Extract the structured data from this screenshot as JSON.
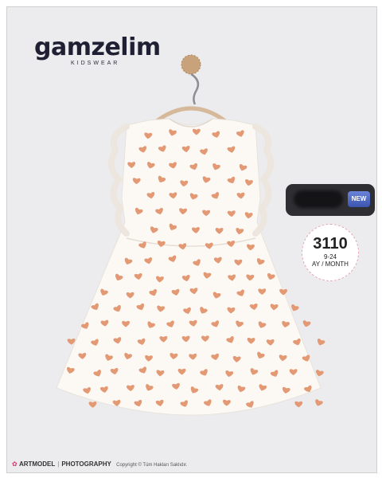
{
  "brand": {
    "name": "gamzelim",
    "tagline": "KIDSWEAR"
  },
  "badge": {
    "new_label": "NEW"
  },
  "size": {
    "code": "3110",
    "range": "9-24",
    "unit": "AY / MONTH"
  },
  "footer": {
    "studio": "ARTMODEL",
    "studio_suffix": "PHOTOGRAPHY",
    "copyright": "Copyright © Tüm Hakları Saklıdır."
  },
  "colors": {
    "heart": "#e39a74",
    "dress": "#fcf9f5",
    "background": "#ececee",
    "hanger_knob": "#c8a27a"
  }
}
